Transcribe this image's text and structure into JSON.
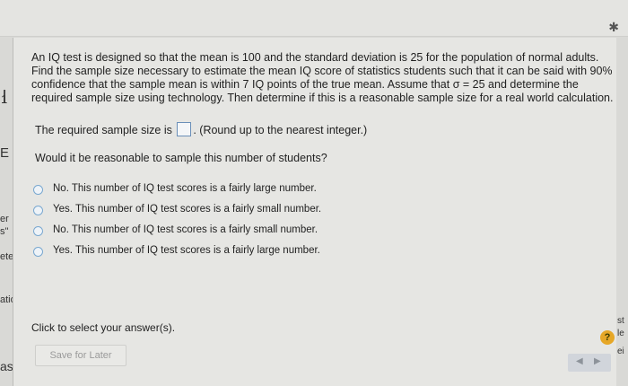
{
  "question": {
    "text": "An IQ test is designed so that the mean is 100 and the standard deviation is 25 for the population of normal adults. Find the sample size necessary to estimate the mean IQ score of statistics students such that it can be said with 90% confidence that the sample mean is within 7 IQ points of the true mean. Assume that σ = 25 and determine the required sample size using technology. Then determine if this is a reasonable sample size for a real world calculation.",
    "answer_prefix": "The required sample size is",
    "answer_suffix": ". (Round up to the nearest integer.)",
    "answer_value": "",
    "question2": "Would it be reasonable to sample this number of students?"
  },
  "options": [
    "No. This number of IQ test scores is a fairly large number.",
    "Yes. This number of IQ test scores is a fairly small number.",
    "No. This number of IQ test scores is a fairly small number.",
    "Yes. This number of IQ test scores is a fairly large number."
  ],
  "footer": {
    "click_select": "Click to select your answer(s).",
    "save_label": "Save for Later",
    "help_label": "?"
  },
  "side_text": {
    "left": [
      "er",
      "s\"",
      "ete",
      "atio",
      "ask"
    ],
    "right": [
      "st",
      "le",
      "ei"
    ]
  }
}
